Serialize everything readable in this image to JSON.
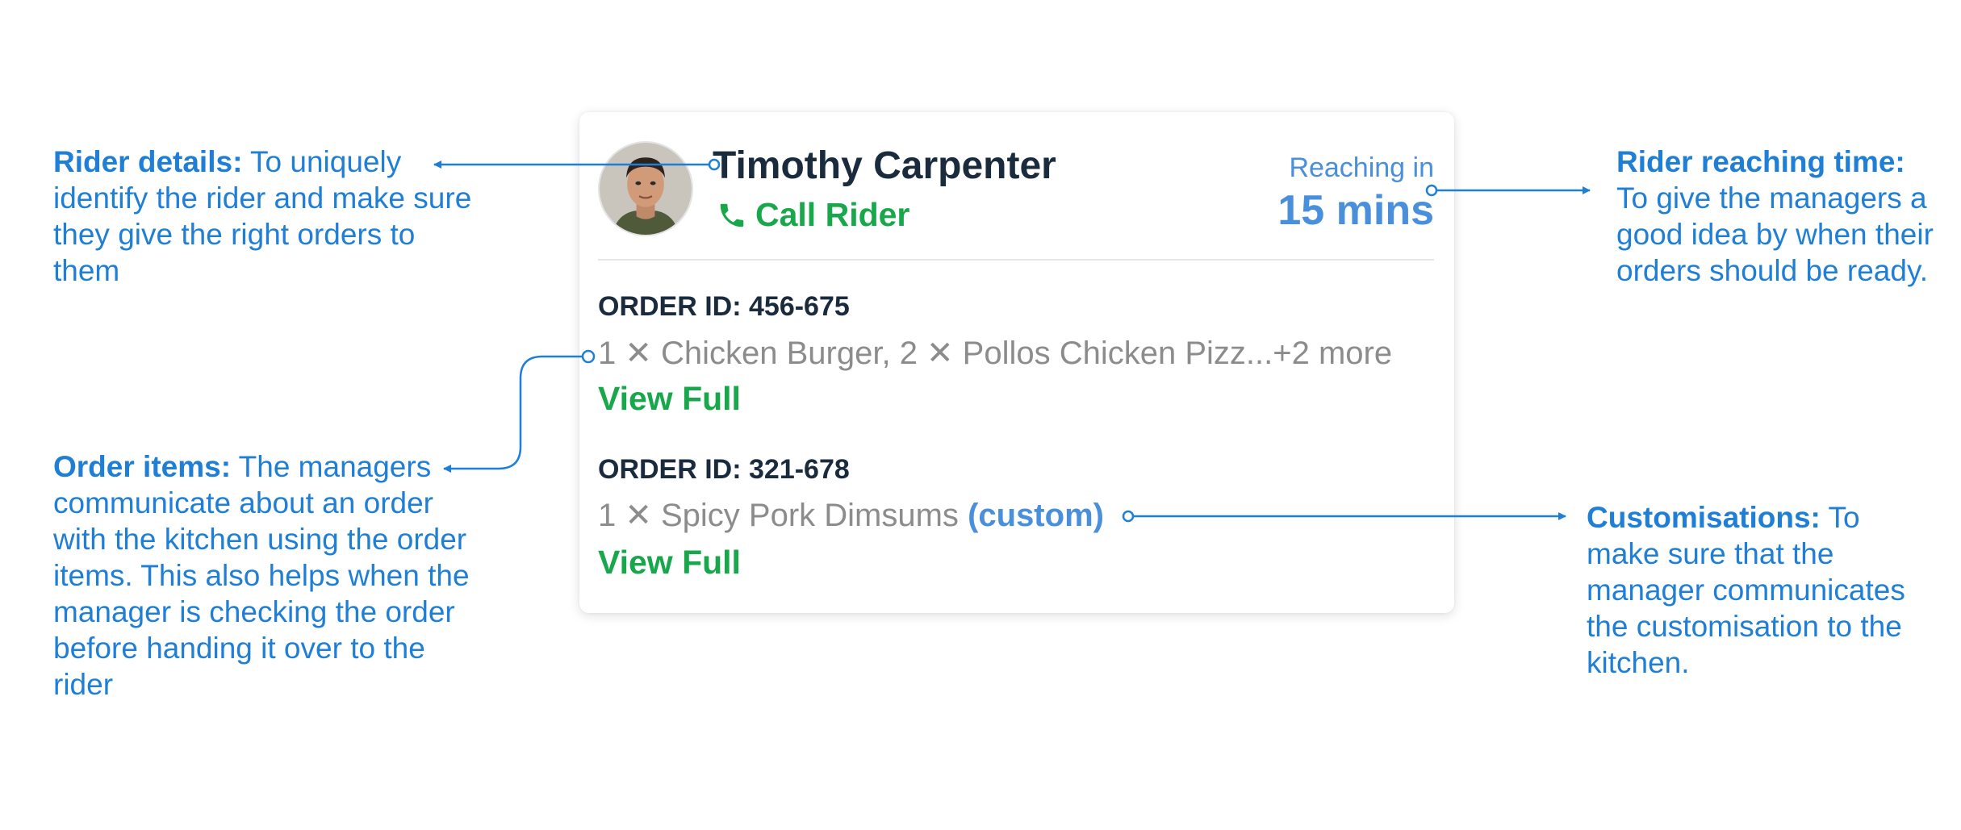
{
  "annotations": {
    "rider_details": {
      "title": "Rider details:",
      "body": "To uniquely identify the rider and make sure they give the right orders to them"
    },
    "order_items": {
      "title": "Order items:",
      "body": "The managers communicate about an order with the kitchen using the order items. This also helps when the manager is checking the order before handing it over to the rider"
    },
    "reaching_time": {
      "title": "Rider reaching time:",
      "body": "To give the managers a good idea by when their orders should be ready."
    },
    "customisations": {
      "title": "Customisations:",
      "body": "To make sure that the manager communicates the customisation to the kitchen."
    }
  },
  "card": {
    "rider_name": "Timothy Carpenter",
    "call_label": "Call Rider",
    "reaching_label": "Reaching in",
    "reaching_time": "15 mins",
    "orders": [
      {
        "id_label": "ORDER ID: 456-675",
        "items": "1 ✕ Chicken Burger, 2 ✕ Pollos Chicken Pizz...+2 more",
        "custom": "",
        "view_label": "View Full"
      },
      {
        "id_label": "ORDER ID: 321-678",
        "items": "1 ✕ Spicy Pork Dimsums",
        "custom": "(custom)",
        "view_label": "View Full"
      }
    ]
  },
  "colors": {
    "annotation_blue": "#1f7fd6",
    "accent_blue": "#4a8fdb",
    "green": "#18a84b",
    "dark_text": "#1a2b3d",
    "muted_text": "#8c8c8c"
  },
  "icons": [
    "avatar-photo",
    "phone-icon"
  ]
}
